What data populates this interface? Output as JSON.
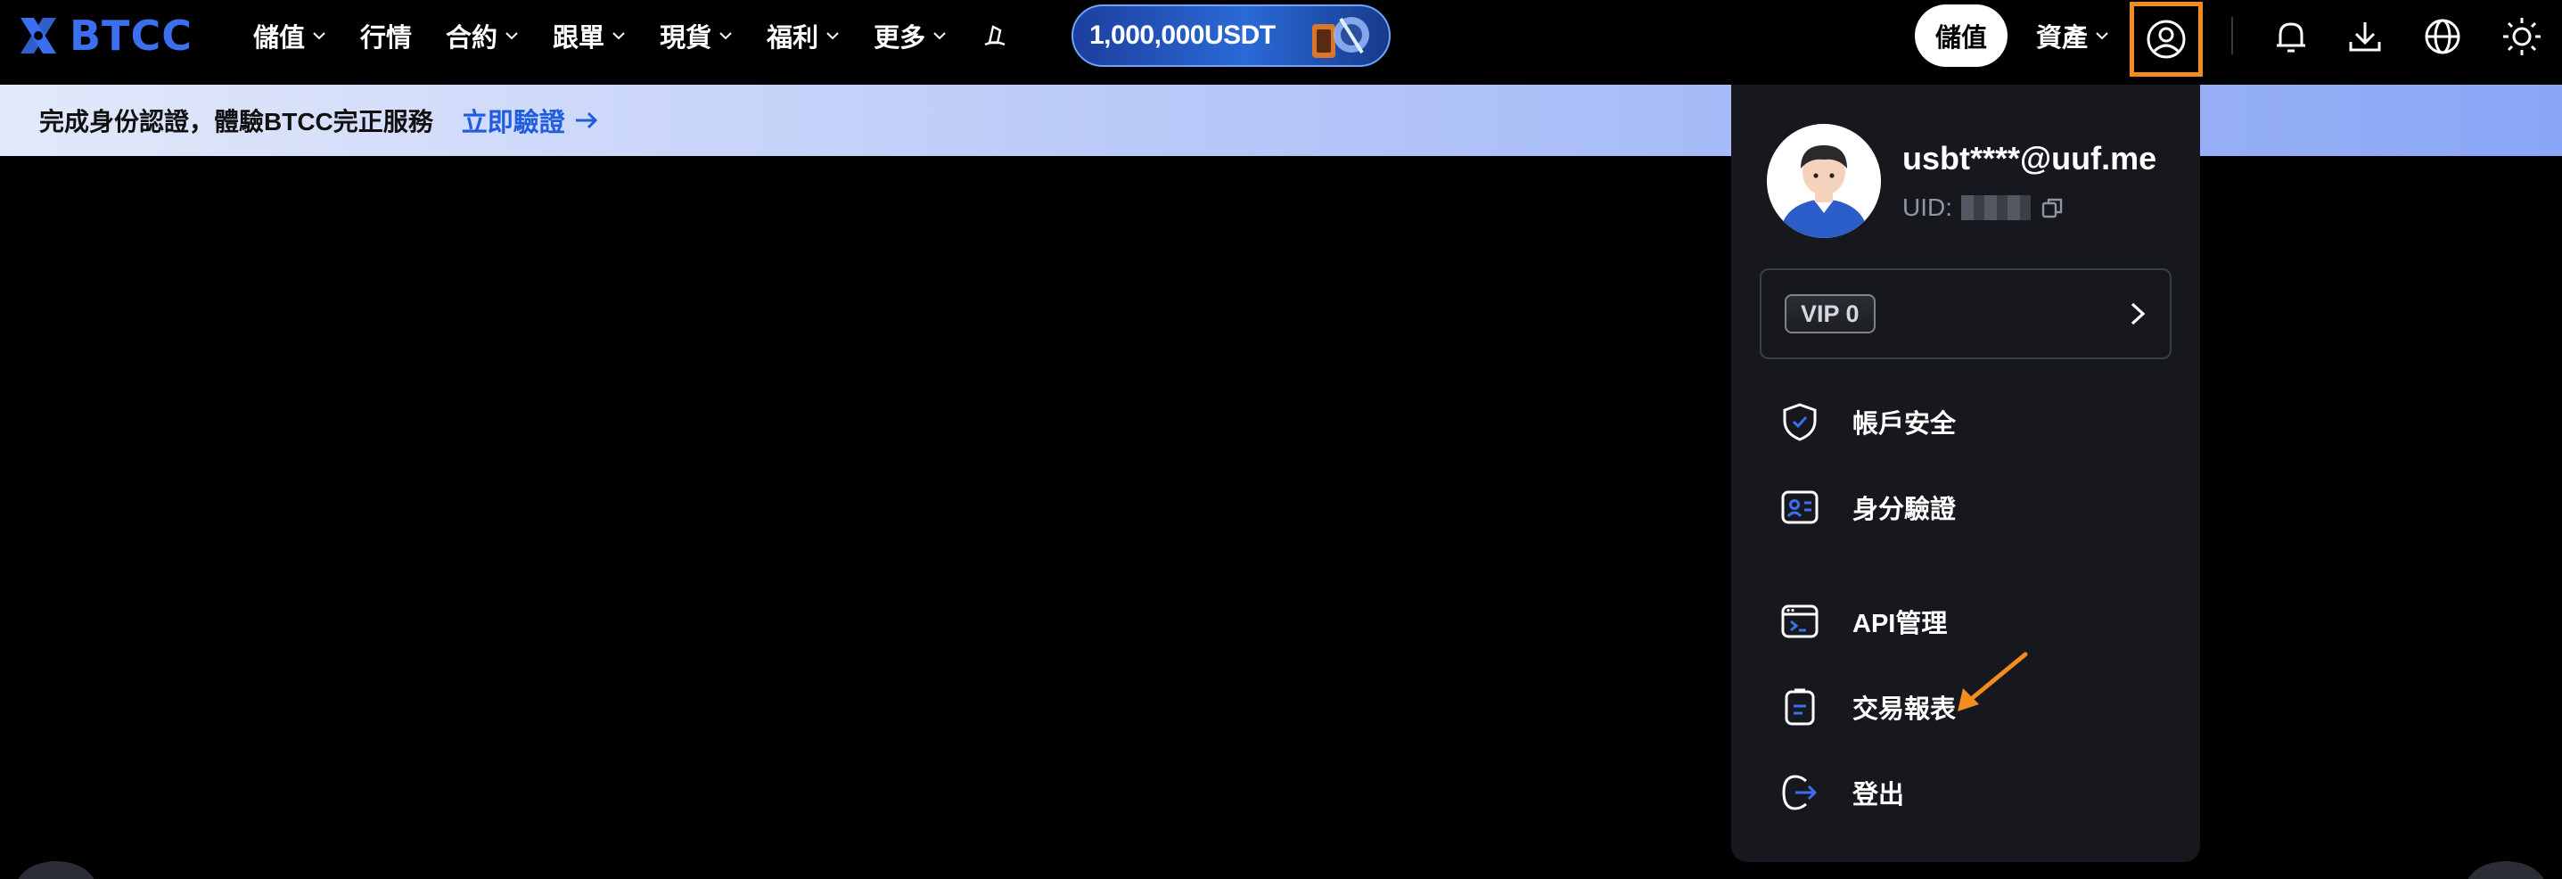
{
  "brand": {
    "name": "BTCC",
    "color": "#3b6ff0"
  },
  "nav": {
    "items": [
      {
        "label": "儲值",
        "has_dropdown": true
      },
      {
        "label": "行情",
        "has_dropdown": false
      },
      {
        "label": "合約",
        "has_dropdown": true
      },
      {
        "label": "跟單",
        "has_dropdown": true
      },
      {
        "label": "現貨",
        "has_dropdown": true
      },
      {
        "label": "福利",
        "has_dropdown": true
      },
      {
        "label": "更多",
        "has_dropdown": true
      }
    ],
    "hat_icon": "wizard-hat-icon",
    "promo_label": "1,000,000USDT"
  },
  "header_right": {
    "deposit_label": "儲值",
    "assets_label": "資產",
    "icons": [
      "user-icon",
      "bell-icon",
      "download-icon",
      "globe-icon",
      "sun-icon"
    ],
    "highlight_color": "#f28c1e"
  },
  "banner": {
    "text": "完成身份認證，體驗BTCC完正服務",
    "link_label": "立即驗證",
    "link_color": "#1f5ce0"
  },
  "account_menu": {
    "email": "usbt****@uuf.me",
    "uid_label": "UID:",
    "vip_label": "VIP 0",
    "items": [
      {
        "label": "帳戶安全",
        "icon": "shield-check-icon"
      },
      {
        "label": "身分驗證",
        "icon": "id-card-icon"
      },
      {
        "label": "API管理",
        "icon": "terminal-window-icon"
      },
      {
        "label": "交易報表",
        "icon": "clipboard-list-icon"
      },
      {
        "label": "登出",
        "icon": "logout-icon"
      }
    ],
    "accent_color": "#3b6ff0"
  },
  "annotation": {
    "arrow_color": "#f28c1e",
    "points_to": "交易報表"
  }
}
